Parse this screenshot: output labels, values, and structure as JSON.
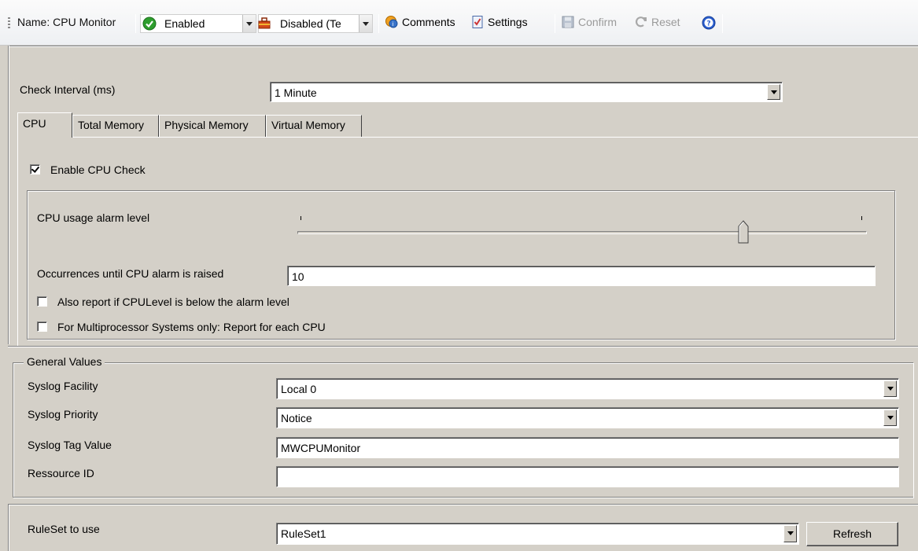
{
  "toolbar": {
    "name_label": "Name: CPU Monitor",
    "enabled_value": "Enabled",
    "disabled_value": "Disabled (Te",
    "comments_label": "Comments",
    "settings_label": "Settings",
    "confirm_label": "Confirm",
    "reset_label": "Reset"
  },
  "check_interval": {
    "label": "Check Interval (ms)",
    "value": "1 Minute"
  },
  "tabs": [
    {
      "label": "CPU"
    },
    {
      "label": "Total Memory"
    },
    {
      "label": "Physical Memory"
    },
    {
      "label": "Virtual Memory"
    }
  ],
  "cpu": {
    "enable_label": "Enable CPU Check",
    "enable_checked": true,
    "alarm_label": "CPU usage alarm level",
    "alarm_level_fraction": 0.79,
    "occurrences_label": "Occurrences until CPU alarm is raised",
    "occurrences_value": "10",
    "below_label": "Also report if CPULevel is below the alarm level",
    "below_checked": false,
    "multi_label": "For Multiprocessor Systems only: Report for each CPU",
    "multi_checked": false
  },
  "general": {
    "title": "General Values",
    "facility_label": "Syslog Facility",
    "facility_value": "Local 0",
    "priority_label": "Syslog Priority",
    "priority_value": "Notice",
    "tag_label": "Syslog Tag Value",
    "tag_value": "MWCPUMonitor",
    "resource_label": "Ressource ID",
    "resource_value": ""
  },
  "ruleset": {
    "label": "RuleSet to use",
    "value": "RuleSet1",
    "refresh_label": "Refresh"
  },
  "colors": {
    "panel": "#d4d0c8",
    "toolbar": "#f5f6f7",
    "enabled_green": "#2e9e2e",
    "help_blue": "#2b5fcf"
  }
}
